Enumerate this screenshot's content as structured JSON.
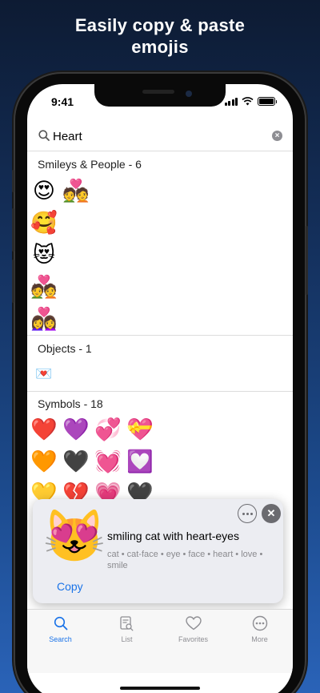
{
  "headline": "Easily copy & paste\nemojis",
  "status": {
    "time": "9:41"
  },
  "search": {
    "value": "Heart",
    "clear_icon": "clear-icon"
  },
  "sections": [
    {
      "label": "Smileys & People - 6",
      "emojis": [
        "😍",
        "💑",
        "🥰",
        "😻",
        "💑",
        "👩‍❤️‍👩"
      ]
    },
    {
      "label": "Objects - 1",
      "emojis": [
        "💌"
      ]
    },
    {
      "label": "Symbols - 18",
      "emojis": [
        "❤️",
        "💜",
        "💞",
        "💝",
        "🧡",
        "🖤",
        "💓",
        "💟",
        "💛",
        "💔",
        "💗",
        "🖤"
      ]
    }
  ],
  "popup": {
    "emoji": "😻",
    "title": "smiling cat with heart-eyes",
    "keywords": "cat • cat-face • eye • face • heart • love • smile",
    "copy_label": "Copy"
  },
  "tabs": [
    {
      "label": "Search",
      "icon": "search-icon",
      "active": true
    },
    {
      "label": "List",
      "icon": "list-icon",
      "active": false
    },
    {
      "label": "Favorites",
      "icon": "heart-icon",
      "active": false
    },
    {
      "label": "More",
      "icon": "more-icon",
      "active": false
    }
  ],
  "colors": {
    "accent": "#1a73e8",
    "background_top": "#0d1b33",
    "background_bottom": "#2a63b8"
  }
}
